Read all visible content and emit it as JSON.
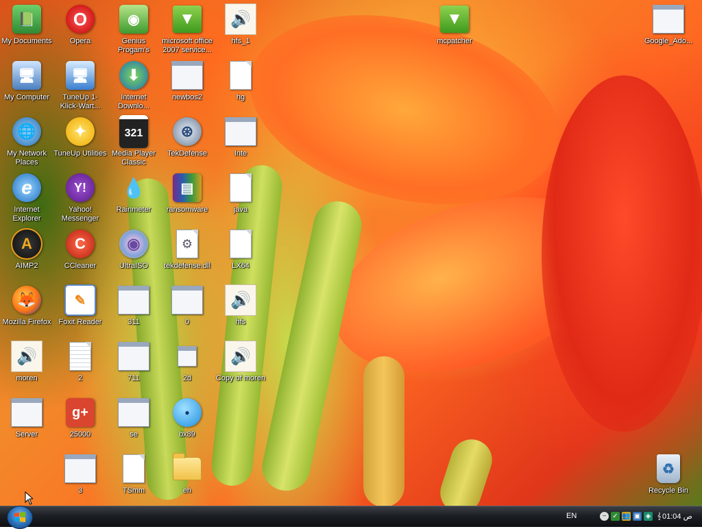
{
  "desktop": {
    "icons": [
      {
        "id": "my-documents",
        "label": "My Documents",
        "icon": "my-documents-icon"
      },
      {
        "id": "opera",
        "label": "Opera",
        "icon": "opera-icon"
      },
      {
        "id": "genius-programs",
        "label": "Genius Progam's",
        "icon": "genius-programs-icon"
      },
      {
        "id": "ms-office-service",
        "label": "microsoft office 2007 service...",
        "icon": "package-icon"
      },
      {
        "id": "hfs-1",
        "label": "hfs_1",
        "icon": "speaker-icon"
      },
      {
        "id": "mcpatcher",
        "label": "mcpatcher",
        "icon": "package-icon"
      },
      {
        "id": "google-ado",
        "label": "Google_Ado...",
        "icon": "window-icon"
      },
      {
        "id": "my-computer",
        "label": "My Computer",
        "icon": "my-computer-icon"
      },
      {
        "id": "tuneup-1klick",
        "label": "TuneUp 1-Klick-Wart...",
        "icon": "tuneup-icon"
      },
      {
        "id": "internet-download",
        "label": "Internet Downlo...",
        "icon": "internet-download-manager-icon"
      },
      {
        "id": "newbos2",
        "label": "newbos2",
        "icon": "window-icon"
      },
      {
        "id": "hg",
        "label": "hg",
        "icon": "document-icon"
      },
      {
        "id": "my-network",
        "label": "My Network Places",
        "icon": "network-icon"
      },
      {
        "id": "tuneup-utilities",
        "label": "TuneUp Utilities",
        "icon": "tuneup-utilities-icon"
      },
      {
        "id": "media-player-classic",
        "label": "Media Player Classic",
        "icon": "media-player-icon"
      },
      {
        "id": "tekdefense",
        "label": "TekDefense",
        "icon": "tekdefense-icon"
      },
      {
        "id": "inte",
        "label": "Inte",
        "icon": "window-icon"
      },
      {
        "id": "internet-explorer",
        "label": "Internet Explorer",
        "icon": "internet-explorer-icon"
      },
      {
        "id": "yahoo-messenger",
        "label": "Yahoo! Messenger",
        "icon": "yahoo-messenger-icon"
      },
      {
        "id": "rainmeter",
        "label": "Rainmeter",
        "icon": "rainmeter-icon"
      },
      {
        "id": "ransomware",
        "label": "ransomware",
        "icon": "winrar-icon"
      },
      {
        "id": "java",
        "label": "java",
        "icon": "document-icon"
      },
      {
        "id": "aimp2",
        "label": "AIMP2",
        "icon": "aimp-icon"
      },
      {
        "id": "ccleaner",
        "label": "CCleaner",
        "icon": "ccleaner-icon"
      },
      {
        "id": "ultraiso",
        "label": "UltraISO",
        "icon": "disc-icon"
      },
      {
        "id": "tekdefense-dll",
        "label": "tekdefense.dll",
        "icon": "dll-icon"
      },
      {
        "id": "lx64",
        "label": "LX64",
        "icon": "document-icon"
      },
      {
        "id": "firefox",
        "label": "Mozilla Firefox",
        "icon": "firefox-icon"
      },
      {
        "id": "foxit-reader",
        "label": "Foxit Reader",
        "icon": "foxit-reader-icon"
      },
      {
        "id": "n311",
        "label": "311",
        "icon": "window-icon"
      },
      {
        "id": "n0",
        "label": "0",
        "icon": "window-icon"
      },
      {
        "id": "hfs",
        "label": "hfs",
        "icon": "speaker-icon"
      },
      {
        "id": "moren",
        "label": "moren",
        "icon": "speaker-icon"
      },
      {
        "id": "n2",
        "label": "2",
        "icon": "text-document-icon"
      },
      {
        "id": "n711",
        "label": "711",
        "icon": "window-icon"
      },
      {
        "id": "n2d",
        "label": "2d",
        "icon": "shortcut-window-icon"
      },
      {
        "id": "copy-of-moren",
        "label": "Copy of moren",
        "icon": "speaker-icon"
      },
      {
        "id": "server",
        "label": "Server",
        "icon": "window-icon"
      },
      {
        "id": "n25000",
        "label": "25000",
        "icon": "google-plus-icon"
      },
      {
        "id": "se",
        "label": "se",
        "icon": "window-icon"
      },
      {
        "id": "bx89",
        "label": "bx89",
        "icon": "bubble-icon"
      },
      {
        "id": "n3",
        "label": "3",
        "icon": "window-icon"
      },
      {
        "id": "tsmm",
        "label": "TSmm",
        "icon": "document-icon"
      },
      {
        "id": "eh",
        "label": "eh",
        "icon": "folder-icon"
      },
      {
        "id": "recycle-bin",
        "label": "Recycle Bin",
        "icon": "recycle-bin-icon"
      }
    ]
  },
  "taskbar": {
    "start_label": "Start",
    "language": "EN",
    "clock": "01:04 ص"
  },
  "glyphs": {
    "opera": "O",
    "gplus": "g+",
    "yahoo": "Y!",
    "speaker": "🔊",
    "ie": "e",
    "aimp": "A",
    "ff": "🦊",
    "ccleaner": "C",
    "mpc": "321",
    "tek": "⊛",
    "arrow": "▼",
    "rar": "▤",
    "gear": "⚙",
    "drop": "💧",
    "disc": "◉",
    "recycle": "♻",
    "monitor": "🖥",
    "globe": "🌐",
    "tune": "✦",
    "foxit": "✎",
    "dl": "⬇",
    "bubble": "●",
    "note": "🗎",
    "docs": "📗"
  }
}
